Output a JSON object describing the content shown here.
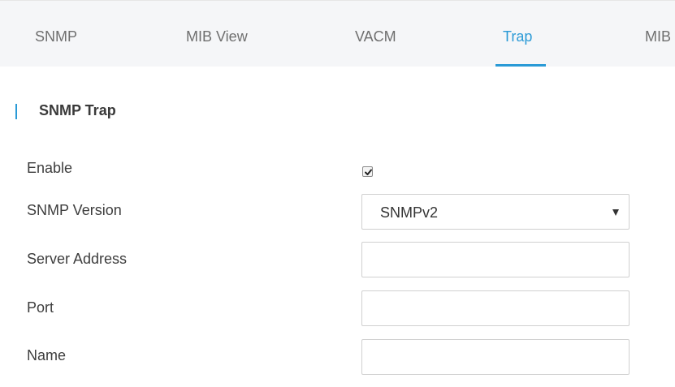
{
  "tabs": [
    {
      "label": "SNMP",
      "active": false
    },
    {
      "label": "MIB View",
      "active": false
    },
    {
      "label": "VACM",
      "active": false
    },
    {
      "label": "Trap",
      "active": true
    },
    {
      "label": "MIB",
      "active": false
    }
  ],
  "section": {
    "title": "SNMP Trap"
  },
  "form": {
    "enable_label": "Enable",
    "enable_checked": true,
    "version_label": "SNMP Version",
    "version_value": "SNMPv2",
    "server_label": "Server Address",
    "server_value": "",
    "port_label": "Port",
    "port_value": "",
    "name_label": "Name",
    "name_value": ""
  },
  "colors": {
    "accent": "#2a9ad6",
    "tabbar_bg": "#f5f6f8"
  },
  "icons": {
    "checkbox": "checkmark-icon",
    "select": "caret-down-icon"
  }
}
